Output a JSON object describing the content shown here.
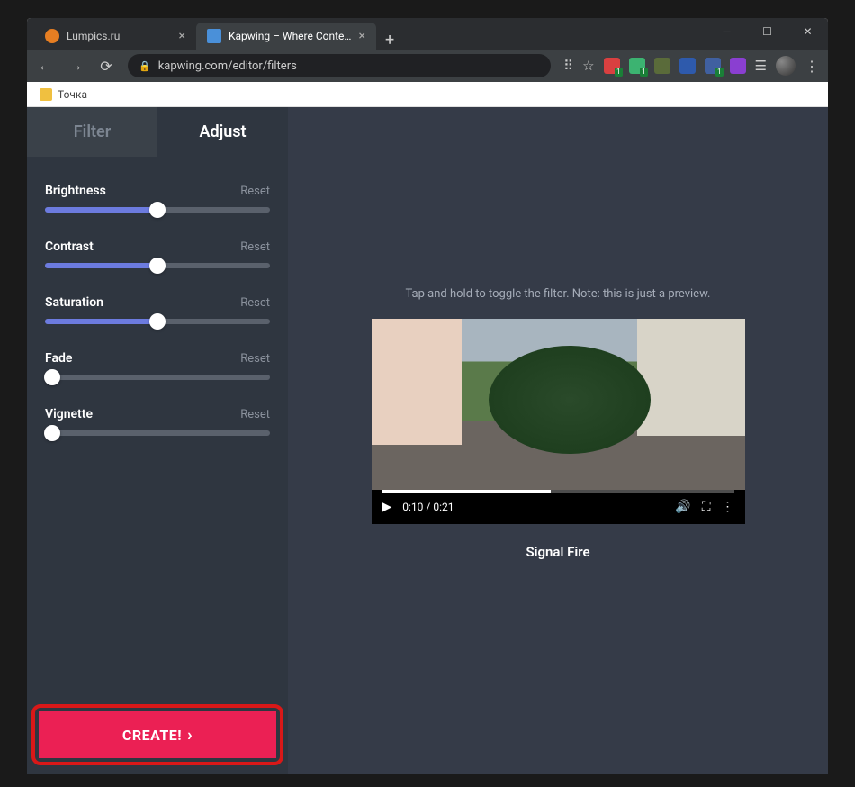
{
  "window": {
    "tabs": [
      {
        "title": "Lumpics.ru",
        "favicon_color": "#e67e22",
        "active": false
      },
      {
        "title": "Kapwing – Where Content Creati",
        "favicon_color": "#4a90d9",
        "active": true
      }
    ]
  },
  "address_bar": {
    "url": "kapwing.com/editor/filters"
  },
  "bookmarks": {
    "item1": "Точка"
  },
  "sidebar": {
    "tabs": {
      "filter": "Filter",
      "adjust": "Adjust"
    },
    "sliders": [
      {
        "label": "Brightness",
        "reset": "Reset",
        "value": 50
      },
      {
        "label": "Contrast",
        "reset": "Reset",
        "value": 50
      },
      {
        "label": "Saturation",
        "reset": "Reset",
        "value": 50
      },
      {
        "label": "Fade",
        "reset": "Reset",
        "value": 3
      },
      {
        "label": "Vignette",
        "reset": "Reset",
        "value": 3
      }
    ],
    "create_label": "CREATE!"
  },
  "preview": {
    "hint": "Tap and hold to toggle the filter. Note: this is just a preview.",
    "time": "0:10 / 0:21",
    "title": "Signal Fire"
  },
  "ext_colors": {
    "translate": "#888",
    "star": "#ccc",
    "e1": "#d94040",
    "e2": "#3cb371",
    "e3": "#5a6b3a",
    "e4": "#2e5aac",
    "e5": "#4060a0",
    "e6": "#8a3fd1"
  }
}
